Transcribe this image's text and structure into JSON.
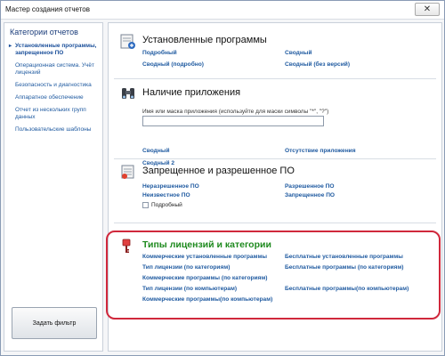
{
  "window": {
    "title": "Мастер создания отчетов",
    "close_glyph": "✕"
  },
  "sidebar": {
    "heading": "Категории отчетов",
    "items": [
      "Установленные программы, запрещенное ПО",
      "Операционная система. Учёт лицензий",
      "Безопасность и диагностика",
      "Аппаратное обеспечение",
      "Отчет из нескольких групп данных",
      "Пользовательские шаблоны"
    ],
    "filter_button": "Задать фильтр"
  },
  "sections": {
    "installed": {
      "title": "Установленные программы",
      "links": [
        "Подробный",
        "Сводный",
        "Сводный (подробно)",
        "Сводный (без версий)"
      ]
    },
    "presence": {
      "title": "Наличие приложения",
      "mask_label": "Имя или маска приложения (используйте для маски символы \"*\", \"?\")",
      "mask_value": "",
      "links": [
        "Сводный",
        "Отсутствие приложения",
        "Сводный 2"
      ]
    },
    "forbidden": {
      "title": "Запрещенное и разрешенное ПО",
      "links": [
        "Неразрешенное ПО",
        "Разрешенное ПО",
        "Неизвестное ПО",
        "Запрещенное ПО"
      ],
      "checkbox_label": "Подробный",
      "checkbox_checked": false
    },
    "licenses": {
      "title": "Типы лицензий и категории",
      "links": [
        "Коммерческие установленные программы",
        "Бесплатные установленные программы",
        "Тип лицензии (по категориям)",
        "Бесплатные программы (по категориям)",
        "Коммерческие программы (по категориям)",
        "Тип лицензии (по компьютерам)",
        "Бесплатные программы(по компьютерам)",
        "Коммерческие программы(по компьютерам)"
      ]
    }
  },
  "colors": {
    "highlight": "#d0283c",
    "link": "#1f5aa0",
    "section_green": "#1e8a1e"
  },
  "icons": [
    "installed-programs-icon",
    "binoculars-icon",
    "forbidden-software-icon",
    "license-key-icon"
  ]
}
